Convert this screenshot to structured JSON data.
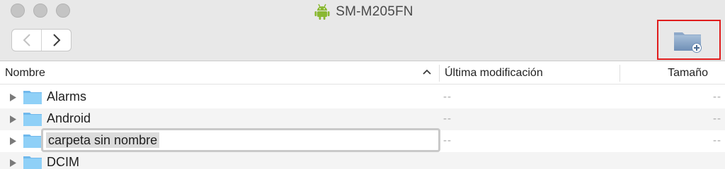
{
  "window": {
    "title": "SM-M205FN",
    "title_icon": "android-icon"
  },
  "toolbar": {
    "back": "chevron-left-icon",
    "forward": "chevron-right-icon",
    "new_folder": "new-folder-icon",
    "highlight_color": "#e01c1c"
  },
  "columns": {
    "name": "Nombre",
    "modified": "Última modificación",
    "size": "Tamaño"
  },
  "rows": [
    {
      "name": "Alarms",
      "modified": "--",
      "size": "--"
    },
    {
      "name": "Android",
      "modified": "--",
      "size": "--"
    },
    {
      "name": "carpeta sin nombre",
      "modified": "--",
      "size": "--",
      "editing": true
    },
    {
      "name": "DCIM",
      "modified": "",
      "size": ""
    }
  ],
  "colors": {
    "folder": "#7dc4f2",
    "android": "#8ab833"
  }
}
